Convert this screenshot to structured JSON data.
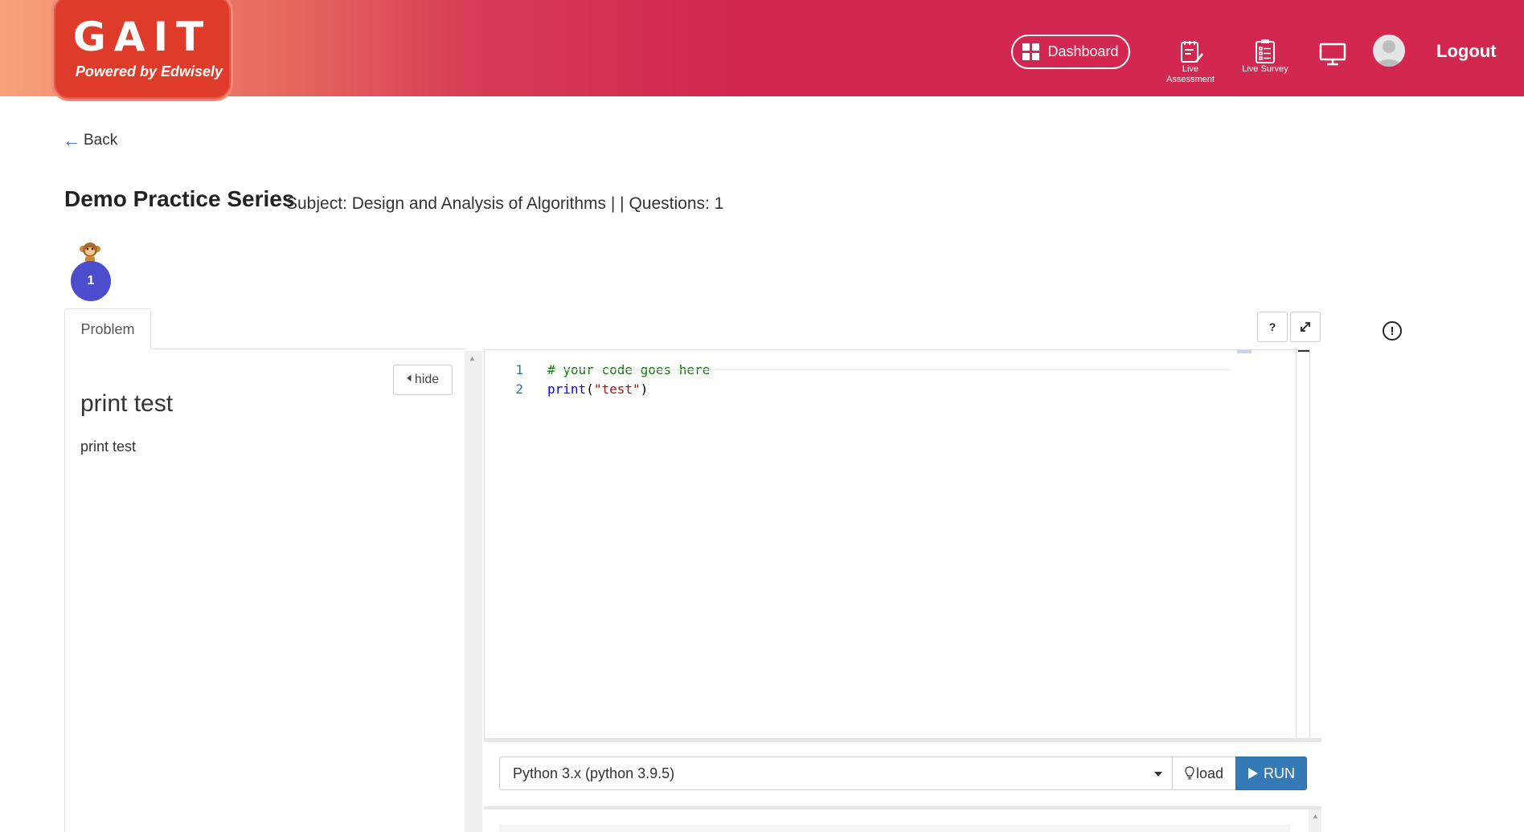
{
  "header": {
    "logo_title": "GAIT",
    "logo_subtitle": "Powered by Edwisely",
    "dashboard_label": "Dashboard",
    "live_assessment_label": "Live Assessment",
    "live_survey_label": "Live Survey",
    "logout_label": "Logout"
  },
  "nav": {
    "back_label": "Back"
  },
  "page": {
    "title": "Demo Practice Series",
    "subject_line": "Subject: Design and Analysis of Algorithms | | Questions: 1"
  },
  "questions": {
    "current_number": "1"
  },
  "tabs": {
    "problem_label": "Problem"
  },
  "problem": {
    "hide_label": "hide",
    "title": "print test",
    "description": "print test"
  },
  "toolbar": {
    "help_label": "?"
  },
  "editor": {
    "lines": [
      {
        "number": "1",
        "text": "# your code goes here"
      },
      {
        "number": "2",
        "code_fn": "print",
        "code_open": "(",
        "code_str": "\"test\"",
        "code_close": ")"
      }
    ]
  },
  "run_bar": {
    "language": "Python 3.x (python 3.9.5)",
    "load_label": "load",
    "run_label": "RUN"
  },
  "colors": {
    "header_accent": "#d12650",
    "question_bubble": "#4b4dcc",
    "run_button": "#337ab7",
    "comment": "#008000",
    "string": "#a31515",
    "keyword": "#0000ff"
  }
}
